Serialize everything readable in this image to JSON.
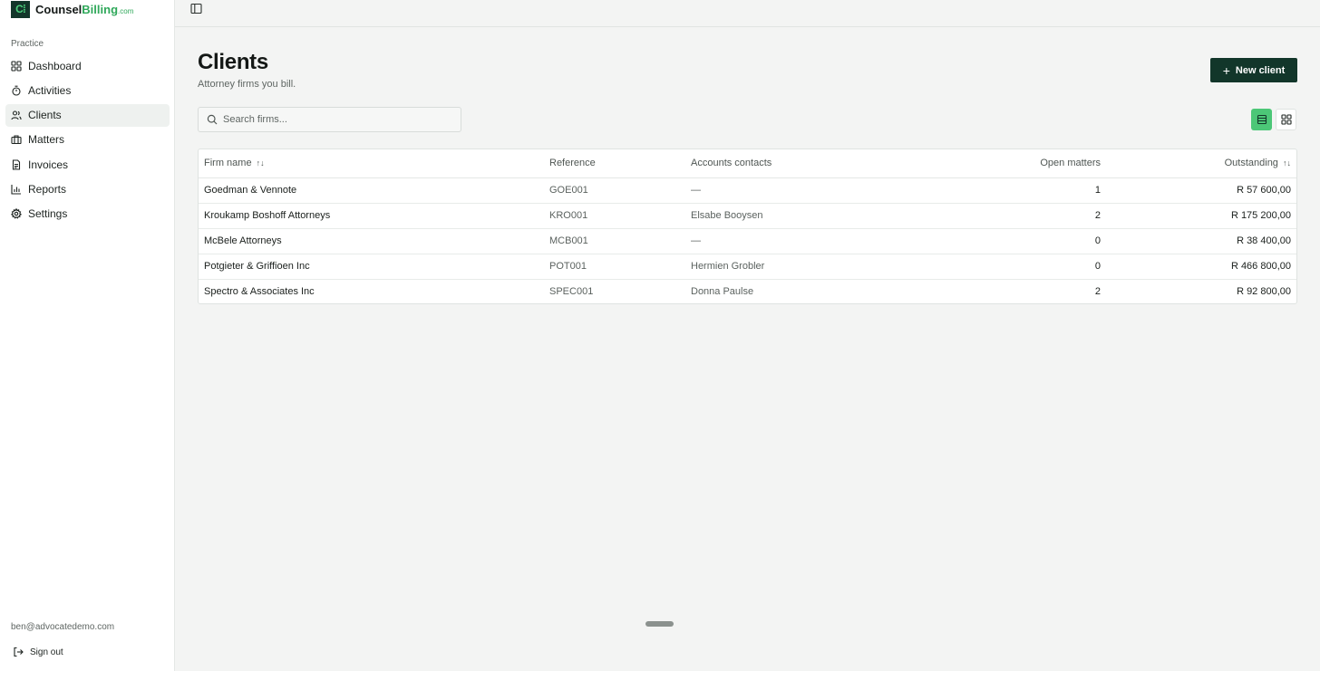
{
  "brand": {
    "mark": "C⁞",
    "name_dark": "Counsel",
    "name_green": "Billing",
    "suffix": ".com"
  },
  "sidebar": {
    "section_label": "Practice",
    "items": [
      {
        "label": "Dashboard",
        "icon": "dashboard-grid-icon"
      },
      {
        "label": "Activities",
        "icon": "stopwatch-icon"
      },
      {
        "label": "Clients",
        "icon": "users-icon",
        "active": true
      },
      {
        "label": "Matters",
        "icon": "briefcase-icon"
      },
      {
        "label": "Invoices",
        "icon": "document-icon"
      },
      {
        "label": "Reports",
        "icon": "bar-chart-icon"
      },
      {
        "label": "Settings",
        "icon": "gear-icon"
      }
    ],
    "user_email": "ben@advocatedemo.com",
    "signout_label": "Sign out"
  },
  "header": {
    "title": "Clients",
    "subtitle": "Attorney firms you bill.",
    "new_button_label": "New client"
  },
  "search": {
    "placeholder": "Search firms..."
  },
  "table": {
    "columns": [
      "Firm name",
      "Reference",
      "Accounts contacts",
      "Open matters",
      "Outstanding"
    ],
    "rows": [
      {
        "firm": "Goedman & Vennote",
        "reference": "GOE001",
        "contact": "—",
        "open_matters": "1",
        "outstanding": "R 57 600,00"
      },
      {
        "firm": "Kroukamp Boshoff Attorneys",
        "reference": "KRO001",
        "contact": "Elsabe Booysen",
        "open_matters": "2",
        "outstanding": "R 175 200,00"
      },
      {
        "firm": "McBele Attorneys",
        "reference": "MCB001",
        "contact": "—",
        "open_matters": "0",
        "outstanding": "R 38 400,00"
      },
      {
        "firm": "Potgieter & Griffioen Inc",
        "reference": "POT001",
        "contact": "Hermien Grobler",
        "open_matters": "0",
        "outstanding": "R 466 800,00"
      },
      {
        "firm": "Spectro & Associates Inc",
        "reference": "SPEC001",
        "contact": "Donna Paulse",
        "open_matters": "2",
        "outstanding": "R 92 800,00"
      }
    ]
  },
  "colors": {
    "brand_dark": "#12362a",
    "brand_green": "#4cc777",
    "page_bg": "#f3f4f3"
  }
}
